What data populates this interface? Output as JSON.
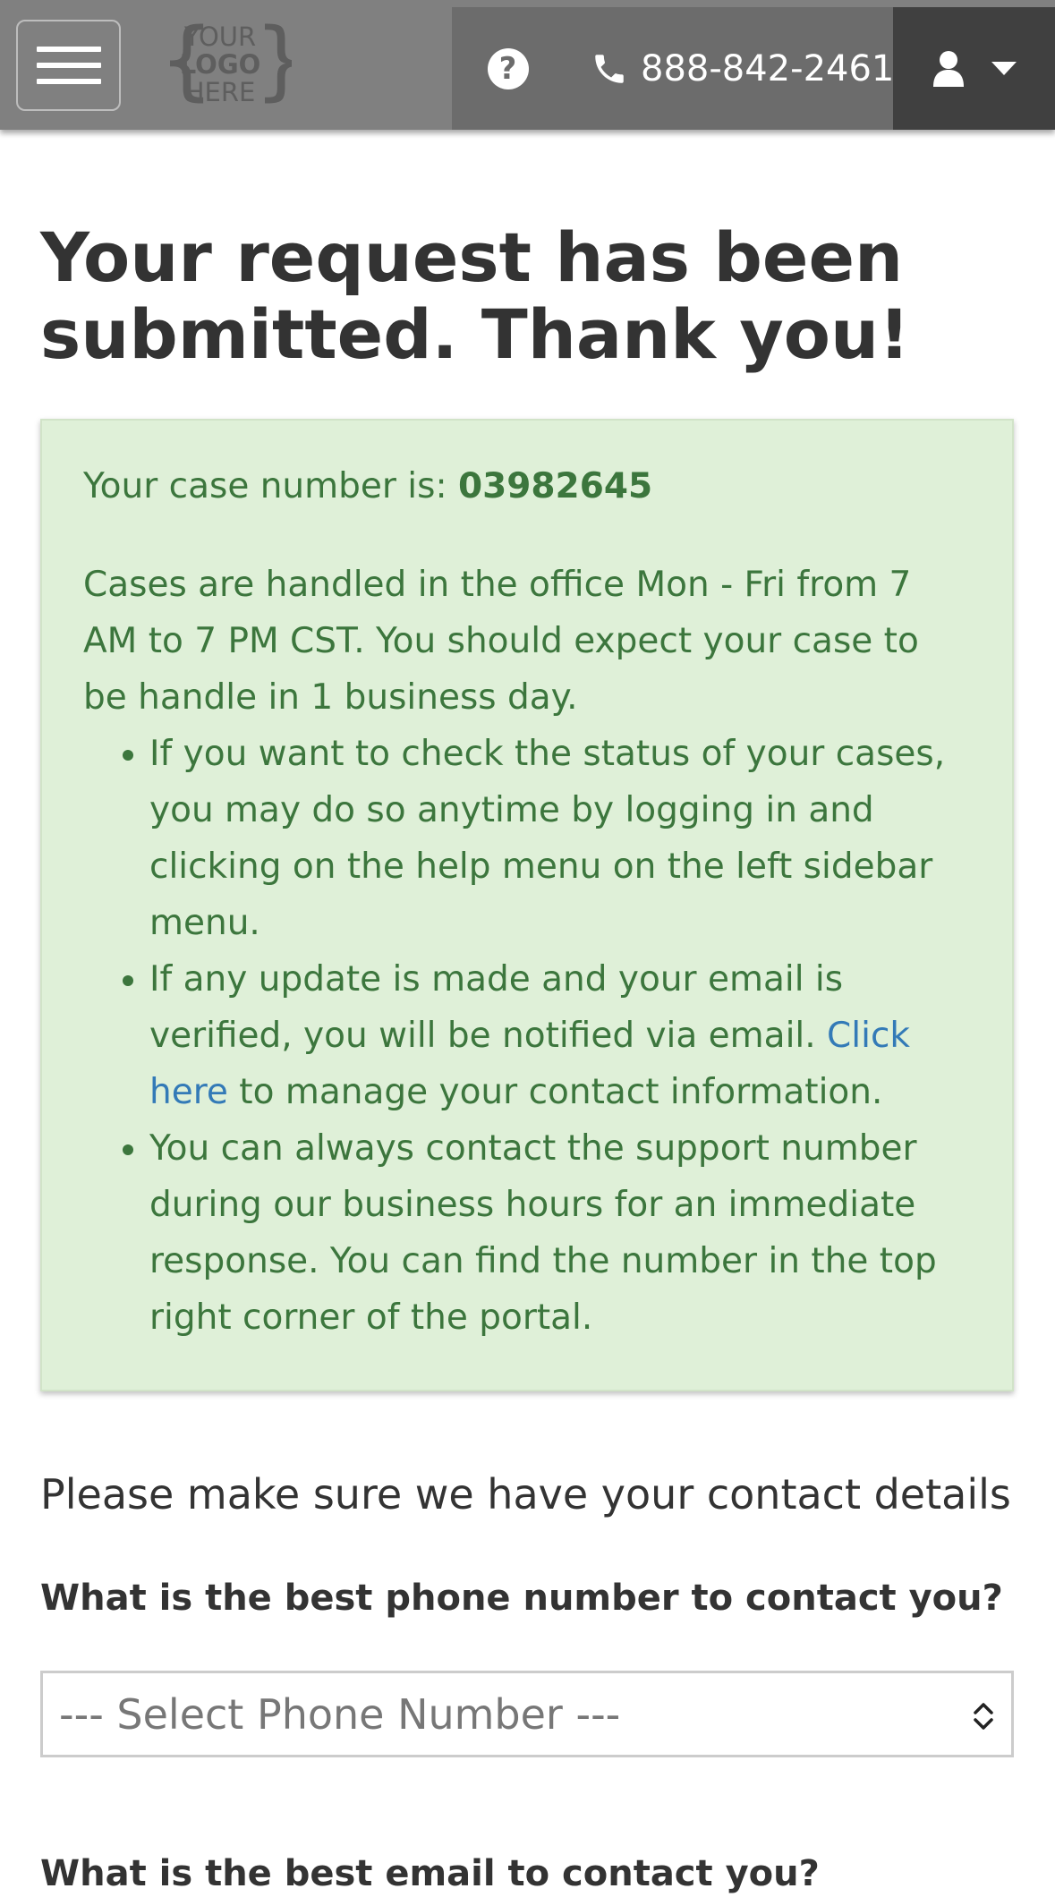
{
  "header": {
    "logo_lines": [
      "YOUR",
      "LOGO",
      "HERE"
    ],
    "phone": "888-842-2461",
    "icons": {
      "menu": "hamburger-icon",
      "help": "question-circle-icon",
      "phone": "phone-icon",
      "user": "user-icon",
      "caret": "caret-down-icon"
    }
  },
  "main": {
    "title": "Your request has been submitted. Thank you!",
    "alert": {
      "case_label": "Your case number is: ",
      "case_number": "03982645",
      "intro": "Cases are handled in the office Mon - Fri from 7 AM to 7 PM CST. You should expect your case to be handle in 1 business day.",
      "bullets": {
        "b1": "If you want to check the status of your cases, you may do so anytime by logging in and clicking on the help menu on the left sidebar menu.",
        "b2_before": "If any update is made and your email is verified, you will be notified via email. ",
        "b2_link": "Click here",
        "b2_after": " to manage your contact information.",
        "b3": "You can always contact the support number during our business hours for an immediate response. You can find the number in the top right corner of the portal."
      }
    },
    "contact_heading": "Please make sure we have your contact details",
    "phone_question": "What is the best phone number to contact you?",
    "phone_select_value": "--- Select Phone Number ---",
    "email_question": "What is the best email to contact you?"
  },
  "colors": {
    "header_bg": "#808080",
    "header_right_bg": "#6c6c6c",
    "user_btn_bg": "#404040",
    "alert_bg": "#dff0d8",
    "alert_text": "#3c763d",
    "link": "#337ab7"
  }
}
